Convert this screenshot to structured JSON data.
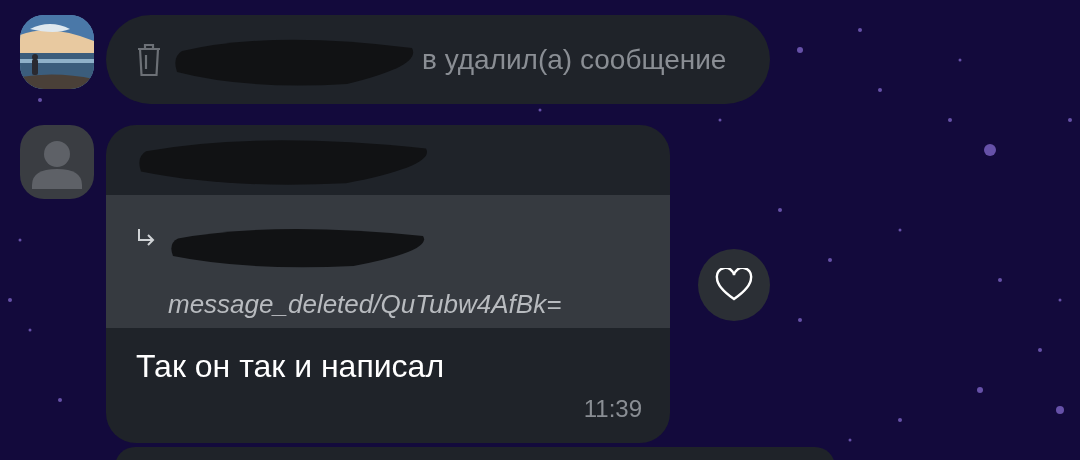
{
  "messages": [
    {
      "kind": "deleted",
      "text": "в удалил(а) сообщение"
    },
    {
      "kind": "reply",
      "avatar": {
        "kind": "default"
      },
      "quote": {
        "text": "message_deleted/QuTubw4AfBk="
      },
      "text": "Так он так и написал",
      "time": "11:39",
      "liked": false
    },
    {
      "kind": "partial"
    }
  ]
}
